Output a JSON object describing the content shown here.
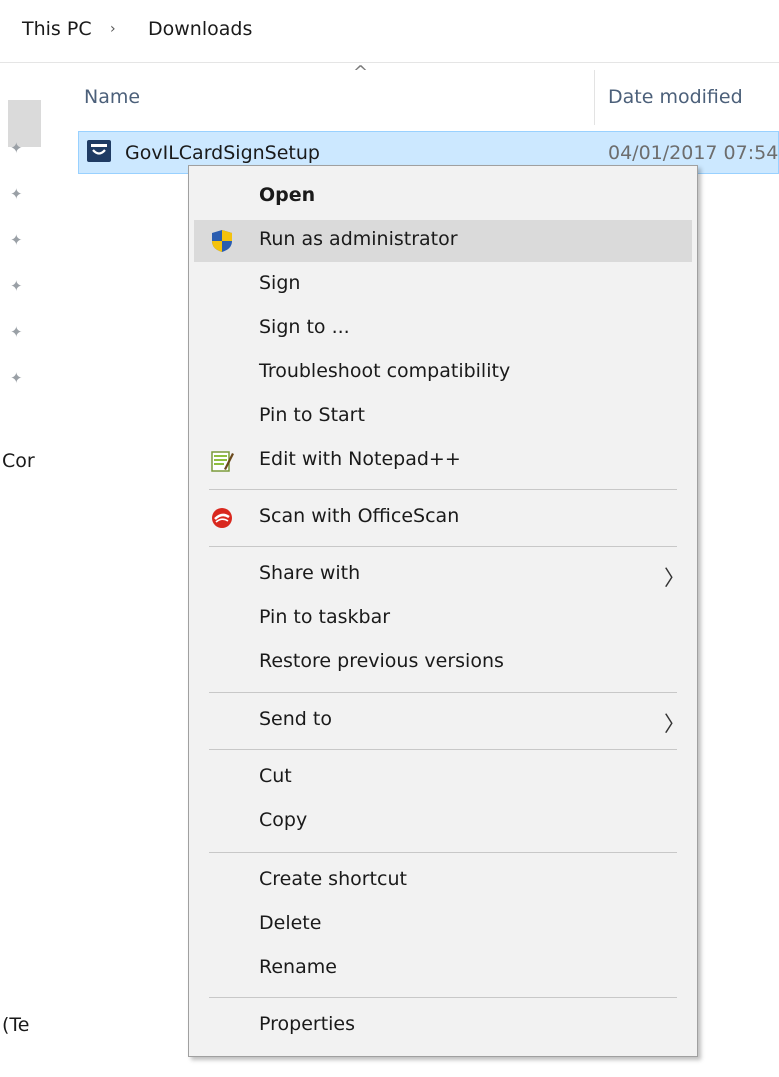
{
  "breadcrumb": {
    "root": "This PC",
    "separator": "›",
    "current": "Downloads"
  },
  "nav": {
    "labels": [
      "Cor",
      "(Te"
    ],
    "pin_glyph": "📌"
  },
  "columns": {
    "name": "Name",
    "date_modified": "Date modified",
    "sort_arrow": "^"
  },
  "file": {
    "name": "GovILCardSignSetup",
    "date": "04/01/2017 07:54",
    "icon": "installer-icon"
  },
  "menu": {
    "items": [
      {
        "label": "Open",
        "bold": true
      },
      {
        "label": "Run as administrator",
        "icon": "uac-shield-icon",
        "hover": true
      },
      {
        "label": "Sign"
      },
      {
        "label": "Sign to ..."
      },
      {
        "label": "Troubleshoot compatibility"
      },
      {
        "label": "Pin to Start"
      },
      {
        "label": "Edit with Notepad++",
        "icon": "notepad-plus-plus-icon"
      },
      {
        "label": "Scan with OfficeScan",
        "icon": "officescan-icon"
      },
      {
        "label": "Share with",
        "submenu": true
      },
      {
        "label": "Pin to taskbar"
      },
      {
        "label": "Restore previous versions"
      },
      {
        "label": "Send to",
        "submenu": true
      },
      {
        "label": "Cut"
      },
      {
        "label": "Copy"
      },
      {
        "label": "Create shortcut"
      },
      {
        "label": "Delete"
      },
      {
        "label": "Rename"
      },
      {
        "label": "Properties"
      }
    ],
    "submenu_glyph": "〉"
  },
  "colors": {
    "selection": "#cce8ff",
    "menu_bg": "#f2f2f2",
    "hover": "#dadada",
    "header_text": "#4c607a"
  }
}
